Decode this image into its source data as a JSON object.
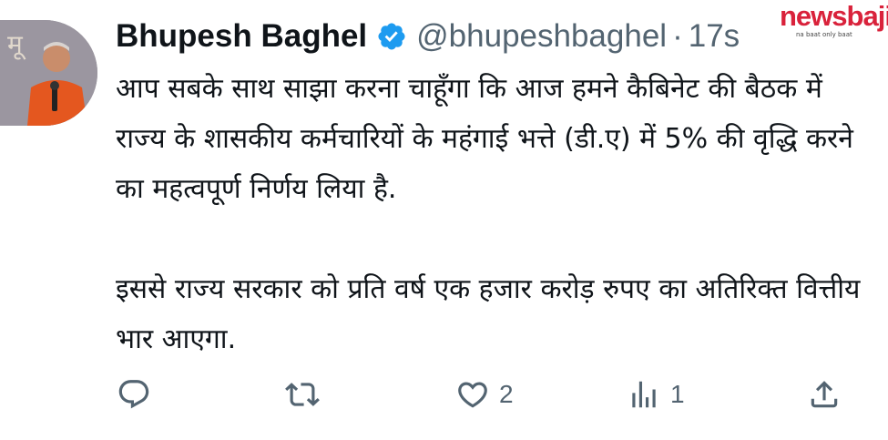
{
  "author": {
    "name": "Bhupesh Baghel",
    "handle": "@bhupeshbaghel",
    "separator": "·",
    "time": "17s",
    "verified_icon": "verified-badge-icon"
  },
  "tweet": {
    "paragraph1": "आप सबके साथ साझा करना चाहूँगा कि आज हमने कैबिनेट की बैठक में राज्य के शासकीय कर्मचारियों के महंगाई भत्ते (डी.ए) में 5% की वृद्धि करने का महत्वपूर्ण निर्णय लिया है.",
    "paragraph2": "इससे राज्य सरकार को प्रति वर्ष एक हजार करोड़ रुपए का अतिरिक्त वित्तीय भार आएगा."
  },
  "actions": {
    "reply": {
      "icon": "reply-icon",
      "count": ""
    },
    "retweet": {
      "icon": "retweet-icon",
      "count": ""
    },
    "like": {
      "icon": "heart-icon",
      "count": "2"
    },
    "views": {
      "icon": "views-icon",
      "count": "1"
    },
    "share": {
      "icon": "share-icon"
    }
  },
  "watermark": {
    "logo_text": "newsbaji",
    "tagline": "na baat only baat"
  },
  "colors": {
    "text": "#0f1419",
    "secondary": "#536471",
    "verified": "#1d9bf0",
    "brand": "#d9223b"
  }
}
